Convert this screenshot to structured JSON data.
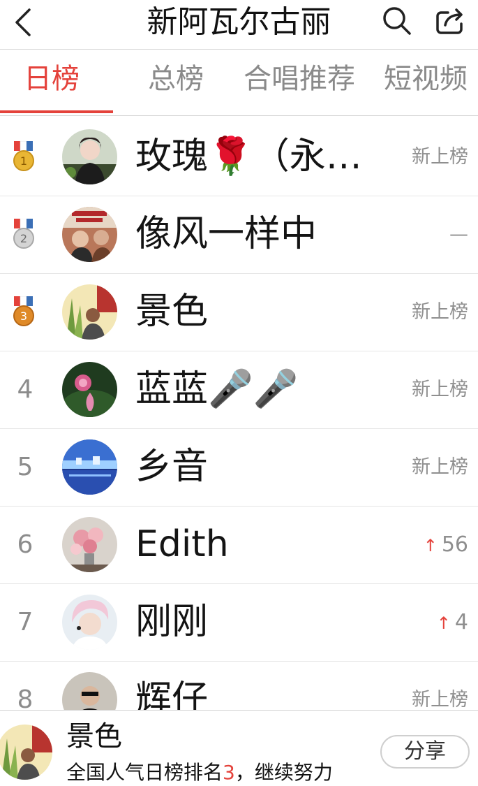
{
  "header": {
    "title": "新阿瓦尔古丽",
    "back_icon": "chevron-left-icon",
    "search_icon": "search-icon",
    "share_icon": "share-icon"
  },
  "tabs": [
    {
      "label": "日榜",
      "active": true
    },
    {
      "label": "总榜",
      "active": false
    },
    {
      "label": "合唱推荐",
      "active": false
    },
    {
      "label": "短视频",
      "active": false
    }
  ],
  "accent_color": "#e4423b",
  "rows": [
    {
      "rank": "1",
      "medal": "gold",
      "name": "玫瑰🌹（永…",
      "status": "新上榜",
      "trend": ""
    },
    {
      "rank": "2",
      "medal": "silver",
      "name": "像风一样中",
      "status": "—",
      "trend": ""
    },
    {
      "rank": "3",
      "medal": "bronze",
      "name": "景色",
      "status": "新上榜",
      "trend": ""
    },
    {
      "rank": "4",
      "medal": "",
      "name": "蓝蓝🎤🎤",
      "status": "新上榜",
      "trend": ""
    },
    {
      "rank": "5",
      "medal": "",
      "name": "乡音",
      "status": "新上榜",
      "trend": ""
    },
    {
      "rank": "6",
      "medal": "",
      "name": "Edith",
      "status": "56",
      "trend": "up"
    },
    {
      "rank": "7",
      "medal": "",
      "name": "刚刚",
      "status": "4",
      "trend": "up"
    },
    {
      "rank": "8",
      "medal": "",
      "name": "辉仔",
      "status": "新上榜",
      "trend": ""
    }
  ],
  "footer": {
    "name": "景色",
    "sub_prefix": "全国人气日榜排名",
    "sub_rank": "3",
    "sub_suffix": "，继续努力",
    "share_label": "分享"
  }
}
